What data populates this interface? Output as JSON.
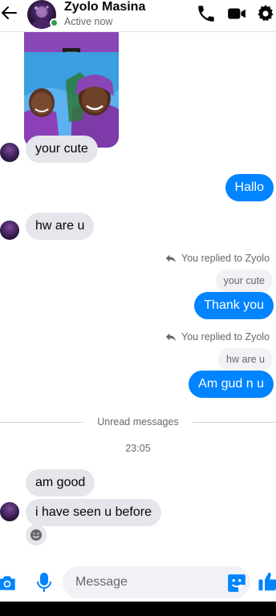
{
  "header": {
    "contact_name": "Zyolo Masina",
    "status": "Active now",
    "icons": [
      "back-arrow-icon",
      "phone-icon",
      "video-camera-icon",
      "gear-icon"
    ]
  },
  "colors": {
    "accent": "#0084ff",
    "incoming_bubble": "#e4e6eb",
    "online": "#31a24c",
    "secondary_text": "#65676b"
  },
  "messages": [
    {
      "direction": "incoming",
      "type": "photo"
    },
    {
      "direction": "incoming",
      "text": "your cute"
    },
    {
      "direction": "outgoing",
      "text": "Hallo"
    },
    {
      "direction": "incoming",
      "text": "hw are u"
    },
    {
      "direction": "outgoing",
      "reply_note": "You replied to Zyolo",
      "quoted": "your cute",
      "text": "Thank you"
    },
    {
      "direction": "outgoing",
      "reply_note": "You replied to Zyolo",
      "quoted": "hw are u",
      "text": "Am gud n u"
    },
    {
      "direction": "incoming",
      "text": "am good"
    },
    {
      "direction": "incoming",
      "text": "i have seen u before"
    }
  ],
  "unread_label": "Unread messages",
  "timestamp": "23:05",
  "composer": {
    "placeholder": "Message",
    "icons": [
      "camera-icon",
      "microphone-icon",
      "sticker-icon",
      "thumbs-up-icon"
    ]
  }
}
